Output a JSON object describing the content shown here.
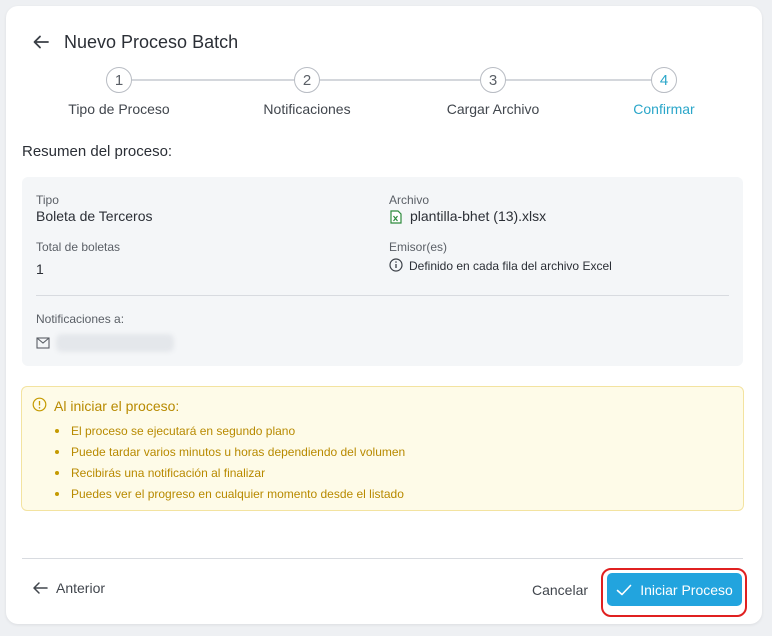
{
  "header": {
    "title": "Nuevo Proceso Batch",
    "back_icon": "arrow-left-icon"
  },
  "stepper": {
    "steps": [
      {
        "number": "1",
        "label": "Tipo de Proceso"
      },
      {
        "number": "2",
        "label": "Notificaciones"
      },
      {
        "number": "3",
        "label": "Cargar Archivo"
      },
      {
        "number": "4",
        "label": "Confirmar"
      }
    ],
    "active_step": 4
  },
  "summary": {
    "title": "Resumen del proceso:",
    "tipo_label": "Tipo",
    "tipo_value": "Boleta de Terceros",
    "archivo_label": "Archivo",
    "archivo_value": "plantilla-bhet (13).xlsx",
    "total_label": "Total de boletas",
    "total_value": "1",
    "emisor_label": "Emisor(es)",
    "emisor_value": "Definido en cada fila del archivo Excel",
    "notificaciones_label": "Notificaciones a:"
  },
  "warning": {
    "title": "Al iniciar el proceso:",
    "items": [
      "El proceso se ejecutará en segundo plano",
      "Puede tardar varios minutos u horas dependiendo del volumen",
      "Recibirás una notificación al finalizar",
      "Puedes ver el progreso en cualquier momento desde el listado"
    ]
  },
  "footer": {
    "prev_label": "Anterior",
    "cancel_label": "Cancelar",
    "start_label": "Iniciar Proceso"
  },
  "colors": {
    "accent": "#2aa6c9",
    "primary_button": "#22a4de",
    "warning_text": "#b88a00",
    "warning_bg": "#fefbe8",
    "highlight": "#e02020",
    "excel_icon": "#2e8b3d"
  }
}
